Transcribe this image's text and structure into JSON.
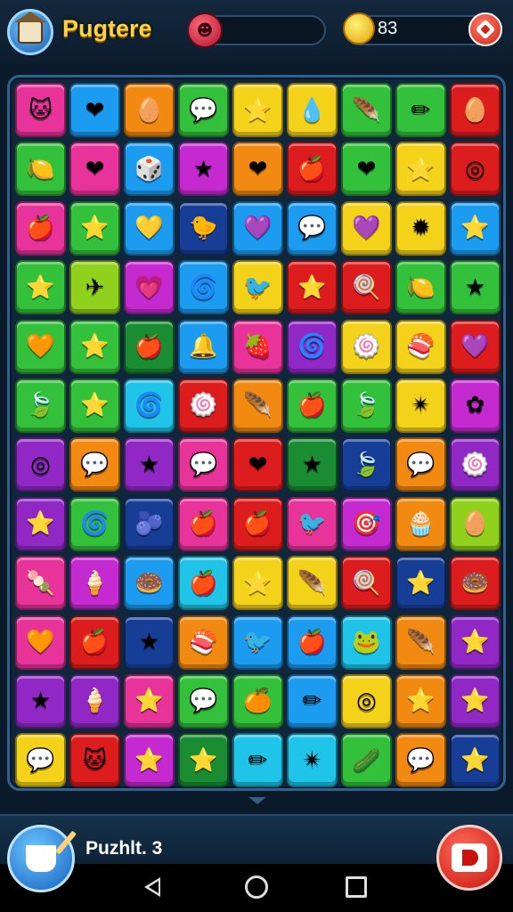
{
  "header": {
    "title": "Pugtere",
    "avatar_icon": "cat-avatar-icon",
    "energy_icon": "red-monster-icon",
    "energy_progress": 0.08,
    "coins": "83",
    "coin_icon": "gold-coin-icon",
    "add_icon": "add-coins-icon"
  },
  "palette": {
    "pink": "#e8339a",
    "blue": "#1c9cf0",
    "orange": "#f28a12",
    "green": "#33c03a",
    "yellow": "#f5d21a",
    "red": "#dd1d1d",
    "purple": "#9128c6",
    "navy": "#173e96",
    "cyan": "#1fc4e8",
    "darkgreen": "#1a8c32",
    "magenta": "#c42ad0",
    "lime": "#8fd11c"
  },
  "board": {
    "rows": [
      [
        {
          "c": "pink",
          "s": "🐱"
        },
        {
          "c": "blue",
          "s": "❤"
        },
        {
          "c": "orange",
          "s": "🥚"
        },
        {
          "c": "green",
          "s": "💬"
        },
        {
          "c": "yellow",
          "s": "⭐"
        },
        {
          "c": "yellow",
          "s": "💧"
        },
        {
          "c": "green",
          "s": "🪶"
        },
        {
          "c": "green",
          "s": "✏"
        },
        {
          "c": "red",
          "s": "🥚"
        }
      ],
      [
        {
          "c": "green",
          "s": "🍋"
        },
        {
          "c": "pink",
          "s": "❤"
        },
        {
          "c": "blue",
          "s": "🎲"
        },
        {
          "c": "magenta",
          "s": "★"
        },
        {
          "c": "orange",
          "s": "❤"
        },
        {
          "c": "red",
          "s": "🍎"
        },
        {
          "c": "green",
          "s": "❤"
        },
        {
          "c": "yellow",
          "s": "⭐"
        },
        {
          "c": "red",
          "s": "◎"
        }
      ],
      [
        {
          "c": "pink",
          "s": "🍎"
        },
        {
          "c": "green",
          "s": "⭐"
        },
        {
          "c": "blue",
          "s": "💛"
        },
        {
          "c": "navy",
          "s": "🐤"
        },
        {
          "c": "blue",
          "s": "💜"
        },
        {
          "c": "blue",
          "s": "💬"
        },
        {
          "c": "yellow",
          "s": "💜"
        },
        {
          "c": "yellow",
          "s": "✹"
        },
        {
          "c": "blue",
          "s": "⭐"
        }
      ],
      [
        {
          "c": "green",
          "s": "⭐"
        },
        {
          "c": "lime",
          "s": "✈"
        },
        {
          "c": "magenta",
          "s": "💗"
        },
        {
          "c": "blue",
          "s": "🌀"
        },
        {
          "c": "yellow",
          "s": "🐦"
        },
        {
          "c": "red",
          "s": "⭐"
        },
        {
          "c": "red",
          "s": "🍭"
        },
        {
          "c": "green",
          "s": "🍋"
        },
        {
          "c": "green",
          "s": "★"
        }
      ],
      [
        {
          "c": "green",
          "s": "🧡"
        },
        {
          "c": "green",
          "s": "⭐"
        },
        {
          "c": "darkgreen",
          "s": "🍎"
        },
        {
          "c": "blue",
          "s": "🔔"
        },
        {
          "c": "pink",
          "s": "🍓"
        },
        {
          "c": "purple",
          "s": "🌀"
        },
        {
          "c": "yellow",
          "s": "🍥"
        },
        {
          "c": "yellow",
          "s": "🍣"
        },
        {
          "c": "red",
          "s": "💜"
        }
      ],
      [
        {
          "c": "green",
          "s": "🍃"
        },
        {
          "c": "green",
          "s": "⭐"
        },
        {
          "c": "cyan",
          "s": "🌀"
        },
        {
          "c": "red",
          "s": "🍥"
        },
        {
          "c": "orange",
          "s": "🪶"
        },
        {
          "c": "green",
          "s": "🍎"
        },
        {
          "c": "green",
          "s": "🍃"
        },
        {
          "c": "yellow",
          "s": "✴"
        },
        {
          "c": "magenta",
          "s": "✿"
        }
      ],
      [
        {
          "c": "purple",
          "s": "◎"
        },
        {
          "c": "orange",
          "s": "💬"
        },
        {
          "c": "purple",
          "s": "★"
        },
        {
          "c": "pink",
          "s": "💬"
        },
        {
          "c": "red",
          "s": "❤"
        },
        {
          "c": "darkgreen",
          "s": "★"
        },
        {
          "c": "navy",
          "s": "🍃"
        },
        {
          "c": "orange",
          "s": "💬"
        },
        {
          "c": "purple",
          "s": "🍥"
        }
      ],
      [
        {
          "c": "purple",
          "s": "⭐"
        },
        {
          "c": "green",
          "s": "🌀"
        },
        {
          "c": "navy",
          "s": "🫐"
        },
        {
          "c": "pink",
          "s": "🍎"
        },
        {
          "c": "red",
          "s": "🍎"
        },
        {
          "c": "pink",
          "s": "🐦"
        },
        {
          "c": "magenta",
          "s": "🎯"
        },
        {
          "c": "orange",
          "s": "🧁"
        },
        {
          "c": "lime",
          "s": "🥚"
        }
      ],
      [
        {
          "c": "pink",
          "s": "🍡"
        },
        {
          "c": "magenta",
          "s": "🍦"
        },
        {
          "c": "blue",
          "s": "🍩"
        },
        {
          "c": "cyan",
          "s": "🍎"
        },
        {
          "c": "yellow",
          "s": "⭐"
        },
        {
          "c": "yellow",
          "s": "🪶"
        },
        {
          "c": "red",
          "s": "🍭"
        },
        {
          "c": "navy",
          "s": "⭐"
        },
        {
          "c": "red",
          "s": "🍩"
        }
      ],
      [
        {
          "c": "pink",
          "s": "🧡"
        },
        {
          "c": "red",
          "s": "🍎"
        },
        {
          "c": "navy",
          "s": "★"
        },
        {
          "c": "orange",
          "s": "🍣"
        },
        {
          "c": "blue",
          "s": "🐦"
        },
        {
          "c": "blue",
          "s": "🍎"
        },
        {
          "c": "cyan",
          "s": "🐸"
        },
        {
          "c": "orange",
          "s": "🪶"
        },
        {
          "c": "purple",
          "s": "⭐"
        }
      ],
      [
        {
          "c": "purple",
          "s": "★"
        },
        {
          "c": "purple",
          "s": "🍦"
        },
        {
          "c": "pink",
          "s": "⭐"
        },
        {
          "c": "green",
          "s": "💬"
        },
        {
          "c": "green",
          "s": "🍊"
        },
        {
          "c": "blue",
          "s": "✏"
        },
        {
          "c": "yellow",
          "s": "◎"
        },
        {
          "c": "orange",
          "s": "⭐"
        },
        {
          "c": "purple",
          "s": "⭐"
        }
      ],
      [
        {
          "c": "yellow",
          "s": "💬"
        },
        {
          "c": "red",
          "s": "🐱"
        },
        {
          "c": "magenta",
          "s": "⭐"
        },
        {
          "c": "darkgreen",
          "s": "⭐"
        },
        {
          "c": "cyan",
          "s": "✏"
        },
        {
          "c": "cyan",
          "s": "✴"
        },
        {
          "c": "green",
          "s": "🥒"
        },
        {
          "c": "orange",
          "s": "💬"
        },
        {
          "c": "navy",
          "s": "⭐"
        }
      ]
    ]
  },
  "footer": {
    "puzzle_label": "Puzhlt. 3",
    "hint_icon": "hint-pencil-icon",
    "stop_icon": "stop-icon"
  },
  "system_nav": {
    "back_icon": "back-icon",
    "home_icon": "home-icon",
    "recent_icon": "recent-apps-icon"
  }
}
